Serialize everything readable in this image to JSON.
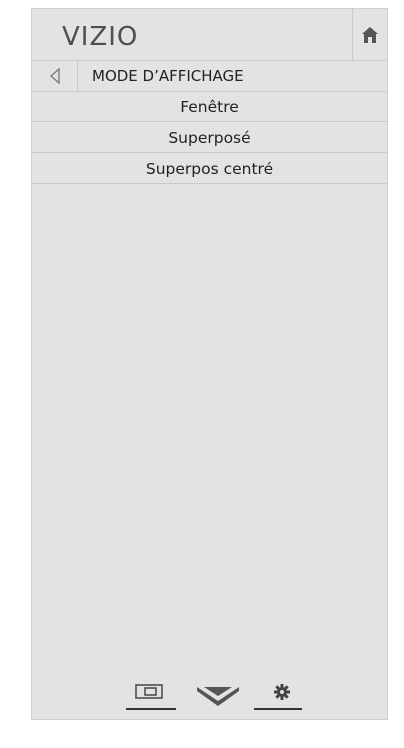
{
  "header": {
    "logo": "VIZIO",
    "home_icon": "home-icon"
  },
  "menu": {
    "back_icon": "chevron-left-icon",
    "title": "MODE D’AFFICHAGE",
    "options": [
      {
        "label": "Fenêtre"
      },
      {
        "label": "Superposé"
      },
      {
        "label": "Superpos centré"
      }
    ]
  },
  "footer": {
    "icons": [
      "picture-mode-icon",
      "chevron-down-icon",
      "gear-icon"
    ]
  },
  "colors": {
    "panel_bg": "#e3e3e3",
    "divider": "#c9c9c9",
    "text": "#222222",
    "icon": "#4f4f4f"
  }
}
